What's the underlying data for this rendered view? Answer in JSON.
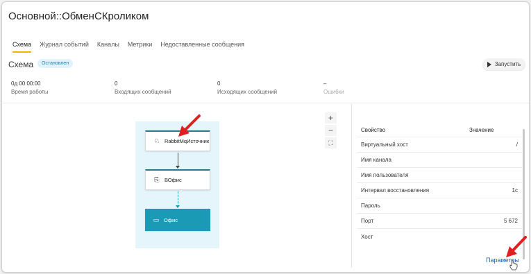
{
  "window": {
    "title": "Основной::ОбменСКроликом"
  },
  "tabs": [
    {
      "label": "Схема"
    },
    {
      "label": "Журнал событий"
    },
    {
      "label": "Каналы"
    },
    {
      "label": "Метрики"
    },
    {
      "label": "Недоставленные сообщения"
    }
  ],
  "section": {
    "title": "Схема",
    "status": "Остановлен",
    "run_label": "Запустить"
  },
  "stats": [
    {
      "value": "0д 00:00:00",
      "label": "Время работы"
    },
    {
      "value": "0",
      "label": "Входящих сообщений"
    },
    {
      "value": "0",
      "label": "Исходящих сообщений"
    },
    {
      "value": "–",
      "label": "Ошибки"
    }
  ],
  "diagram": {
    "nodes": [
      {
        "label": "RabbitMqИсточник",
        "icon": "rabbit-icon"
      },
      {
        "label": "ВОфис",
        "icon": "connector-icon"
      },
      {
        "label": "Офис",
        "icon": "monitor-icon"
      }
    ],
    "zoom": {
      "in": "+",
      "out": "−",
      "fit": "⛶"
    }
  },
  "properties": {
    "header": {
      "key": "Свойство",
      "value": "Значение"
    },
    "rows": [
      {
        "key": "Виртуальный хост",
        "value": "/"
      },
      {
        "key": "Имя канала",
        "value": ""
      },
      {
        "key": "Имя пользователя",
        "value": ""
      },
      {
        "key": "Интервал восстановления",
        "value": "1с"
      },
      {
        "key": "Пароль",
        "value": ""
      },
      {
        "key": "Порт",
        "value": "5 672"
      },
      {
        "key": "Хост",
        "value": ""
      }
    ],
    "link": "Параметры"
  },
  "colors": {
    "accent": "#f4b400",
    "node_dark": "#1a9ab4",
    "annotation": "#e02020"
  }
}
